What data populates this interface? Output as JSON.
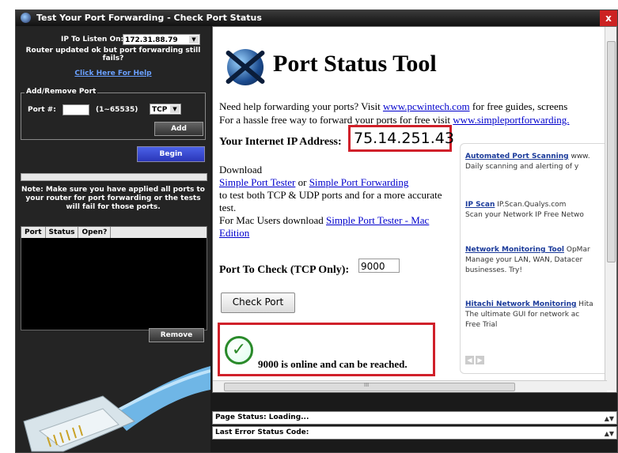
{
  "window": {
    "title": "Test Your Port Forwarding - Check Port Status",
    "close": "x"
  },
  "left": {
    "ip_label": "IP To Listen On:",
    "ip_value": "172.31.88.79",
    "router_note": "Router updated ok but port forwarding still fails?",
    "help_link": "Click Here For Help",
    "addremove_legend": "Add/Remove Port",
    "port_label": "Port #:",
    "port_value": "",
    "port_range": "(1~65535)",
    "protocol": "TCP",
    "add_button": "Add",
    "begin_button": "Begin",
    "note": "Note: Make sure you have applied all ports to your router for port forwarding or the tests will fail for those ports.",
    "table_headers": [
      "Port",
      "Status",
      "Open?"
    ],
    "remove_button": "Remove"
  },
  "main": {
    "title": "Port Status Tool",
    "intro1_pre": "Need help forwarding your ports? Visit ",
    "intro1_link": "www.pcwintech.com",
    "intro1_post": " for free guides, screens",
    "intro2_pre": "For a hassle free way to forward your ports for free visit ",
    "intro2_link": "www.simpleportforwarding.",
    "ip_label": "Your Internet IP Address:",
    "ip_value": "75.14.251.43",
    "download": "Download",
    "tester_link": "Simple Port Tester",
    "or": " or ",
    "spf_link": "Simple Port Forwarding",
    "download_desc": "to test both TCP & UDP ports and for a more accurate test.",
    "mac_pre": "For Mac Users download ",
    "mac_link": "Simple Port Tester - Mac Edition",
    "check_label": "Port To Check (TCP Only):",
    "check_value": "9000",
    "check_button": "Check Port",
    "result": "9000 is online and can be reached.",
    "ok_glyph": "✓",
    "hscroll_mark": "III"
  },
  "ads": [
    {
      "title": "Automated Port Scanning",
      "suffix": " www.",
      "desc": "Daily scanning and alerting of y"
    },
    {
      "title": "IP Scan",
      "suffix": " IP.Scan.Qualys.com",
      "desc": "Scan your Network IP Free Netwo"
    },
    {
      "title": "Network Monitoring Tool",
      "suffix": " OpMar",
      "desc": "Manage your LAN, WAN, Datacer",
      "desc2": "businesses. Try!"
    },
    {
      "title": "Hitachi Network Monitoring",
      "suffix": " Hita",
      "desc": "The ultimate GUI for network ac",
      "desc2": "Free Trial"
    }
  ],
  "status": {
    "page_status": "Page Status: Loading...",
    "last_error": "Last Error Status Code:"
  }
}
